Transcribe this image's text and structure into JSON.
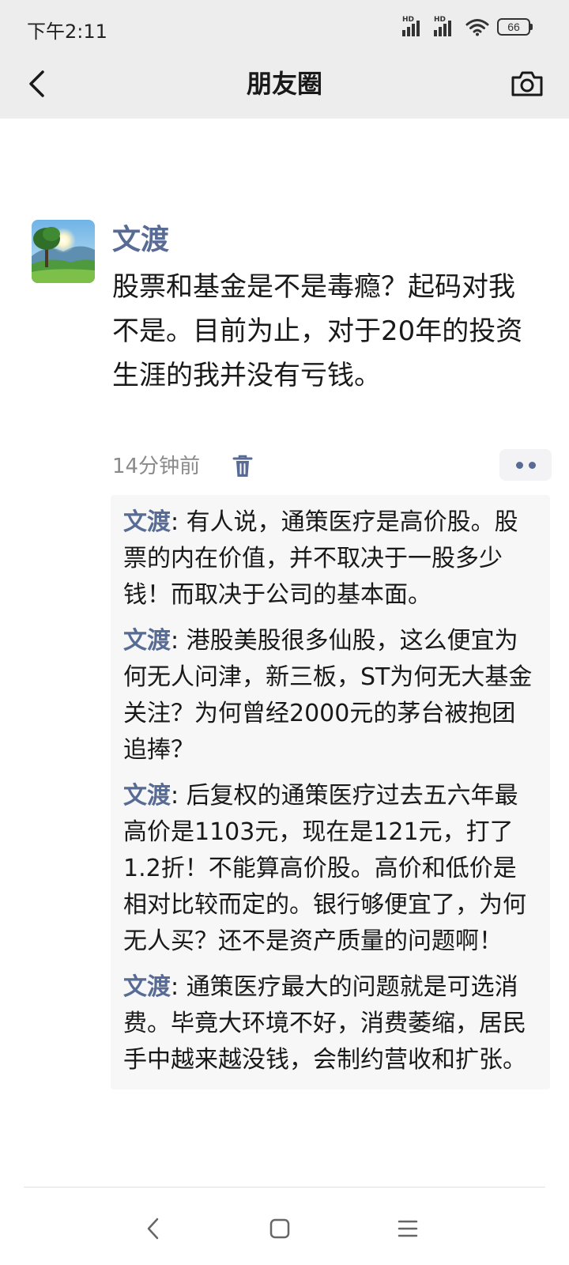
{
  "status_bar": {
    "time": "下午2:11",
    "signal_1_label": "HD",
    "signal_2_label": "HD",
    "battery": "66"
  },
  "nav": {
    "title": "朋友圈",
    "back_icon": "chevron-left-icon",
    "camera_icon": "camera-icon"
  },
  "post": {
    "author": "文渡",
    "text": "股票和基金是不是毒瘾？起码对我不是。目前为止，对于20年的投资生涯的我并没有亏钱。",
    "time": "14分钟前",
    "delete_icon": "trash-icon",
    "more_icon": "more-dots-icon"
  },
  "comments": [
    {
      "author": "文渡",
      "separator": ": ",
      "text": "有人说，通策医疗是高价股。股票的内在价值，并不取决于一股多少钱！而取决于公司的基本面。"
    },
    {
      "author": "文渡",
      "separator": ": ",
      "text": "港股美股很多仙股，这么便宜为何无人问津，新三板，ST为何无大基金关注？为何曾经2000元的茅台被抱团追捧？"
    },
    {
      "author": "文渡",
      "separator": ": ",
      "text": "后复权的通策医疗过去五六年最高价是1103元，现在是121元，打了1.2折！不能算高价股。高价和低价是相对比较而定的。银行够便宜了，为何无人买？还不是资产质量的问题啊！"
    },
    {
      "author": "文渡",
      "separator": ": ",
      "text": "通策医疗最大的问题就是可选消费。毕竟大环境不好，消费萎缩，居民手中越来越没钱，会制约营收和扩张。"
    }
  ],
  "system_nav": {
    "back_icon": "triangle-back-icon",
    "home_icon": "square-home-icon",
    "menu_icon": "hamburger-menu-icon"
  },
  "colors": {
    "accent_name": "#576b95",
    "bar_background": "#ededed",
    "comment_background": "#f7f7f7",
    "meta_text": "#8a8a8a"
  }
}
